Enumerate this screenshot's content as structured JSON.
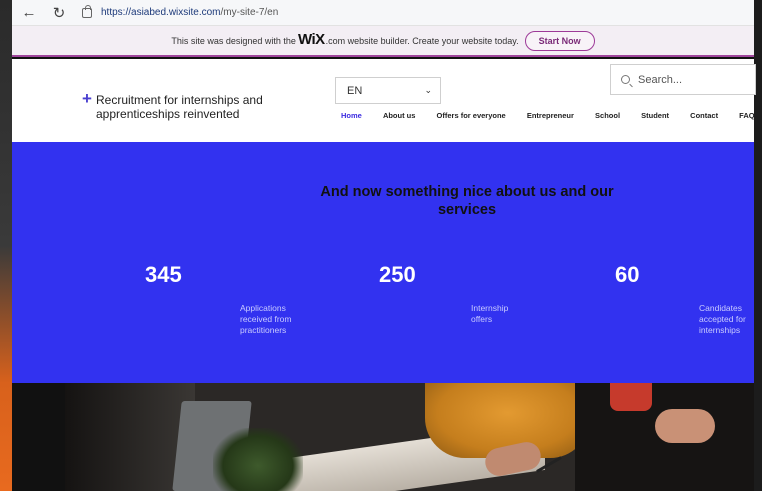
{
  "browser": {
    "url_host": "https://asiabed.wixsite.com",
    "url_path": "/my-site-7/en"
  },
  "banner": {
    "text_before": "This site was designed with the",
    "logo": "WiX",
    "text_after": ".com website builder. Create your website today.",
    "button": "Start Now"
  },
  "header": {
    "brand_line1": "Recruitment for internships and",
    "brand_line2": "apprenticeships reinvented",
    "language": "EN",
    "search_placeholder": "Search...",
    "nav": [
      "Home",
      "About us",
      "Offers for everyone",
      "Entrepreneur",
      "School",
      "Student",
      "Contact",
      "FAQ"
    ],
    "active_nav": "Home"
  },
  "hero": {
    "tagline": "And now something nice about us and our services",
    "stats": [
      {
        "number": "345",
        "desc1": "Applications",
        "desc2": "received from",
        "desc3": "practitioners"
      },
      {
        "number": "250",
        "desc1": "Internship",
        "desc2": "offers",
        "desc3": ""
      },
      {
        "number": "60",
        "desc1": "Candidates",
        "desc2": "accepted for",
        "desc3": "internships"
      }
    ]
  },
  "colors": {
    "accent_blue": "#3232f0",
    "wix_purple": "#9d3a98",
    "active_nav": "#3b2be0"
  }
}
